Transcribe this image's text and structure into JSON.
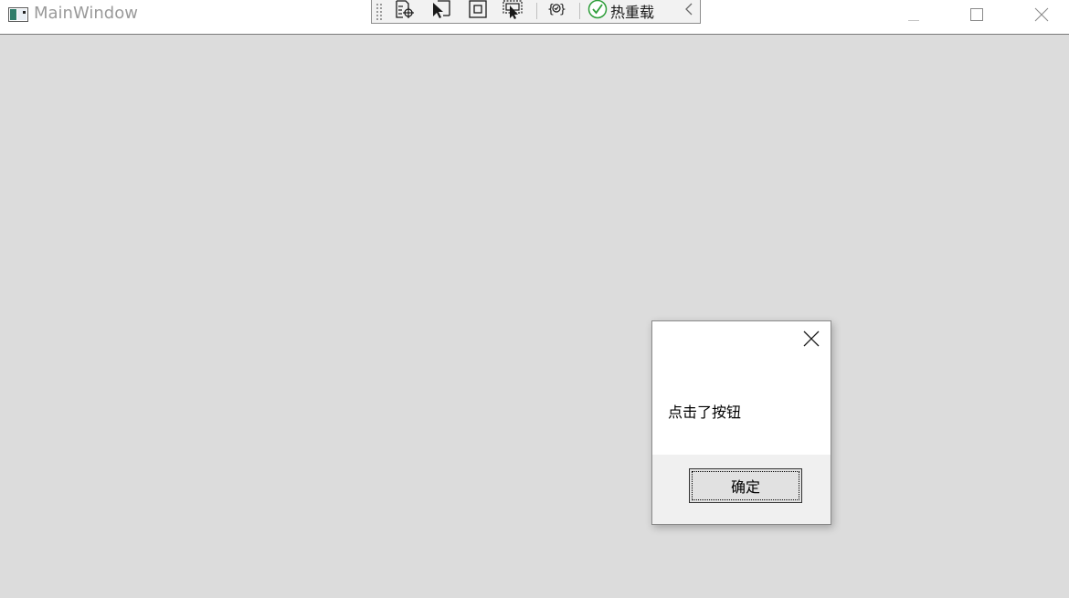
{
  "window": {
    "title": "MainWindow",
    "icon": "app-window-icon",
    "controls": {
      "minimize_icon": "minimize-icon",
      "maximize_icon": "maximize-icon",
      "close_icon": "close-icon"
    }
  },
  "debug_toolbar": {
    "buttons": [
      {
        "icon": "go-to-live-visual-tree-icon"
      },
      {
        "icon": "select-element-icon"
      },
      {
        "icon": "display-layout-adorners-icon"
      },
      {
        "icon": "track-focused-element-icon"
      },
      {
        "icon": "binding-failures-icon"
      }
    ],
    "hot_reload": {
      "label": "热重载",
      "status_icon": "check-circle-icon",
      "status_color": "#2e9e3a"
    },
    "collapse_icon": "chevron-left-icon"
  },
  "message_box": {
    "message": "点击了按钮",
    "ok_label": "确定",
    "close_icon": "close-icon"
  }
}
